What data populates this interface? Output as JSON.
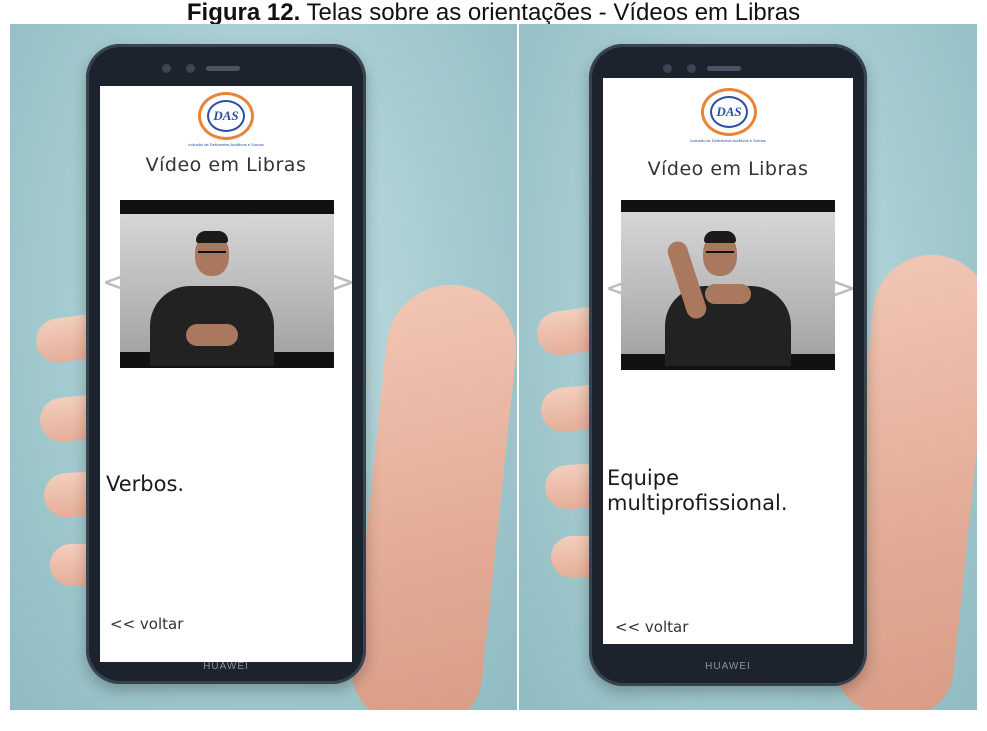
{
  "figure_caption": {
    "label": "Figura 12.",
    "text": "Telas sobre as orientações - Vídeos em Libras"
  },
  "phones": [
    {
      "brand": "HUAWEI",
      "logo_text": "DAS",
      "logo_subtitle": "Inclusão de Deficientes Auditivos e Surdos",
      "screen_title": "Vídeo em Libras",
      "prev_arrow": "<",
      "next_arrow": ">",
      "sign_caption": "Verbos.",
      "back_link": "<< voltar"
    },
    {
      "brand": "HUAWEI",
      "logo_text": "DAS",
      "logo_subtitle": "Inclusão de Deficientes Auditivos e Surdos",
      "screen_title": "Vídeo em Libras",
      "prev_arrow": "<",
      "next_arrow": ">",
      "sign_caption": "Equipe multiprofissional.",
      "back_link": "<< voltar"
    }
  ],
  "colors": {
    "background_photo": "#a4cbd0",
    "phone_body": "#1c232c",
    "logo_ring": "#e8843a",
    "logo_blue": "#2d4fa3"
  }
}
